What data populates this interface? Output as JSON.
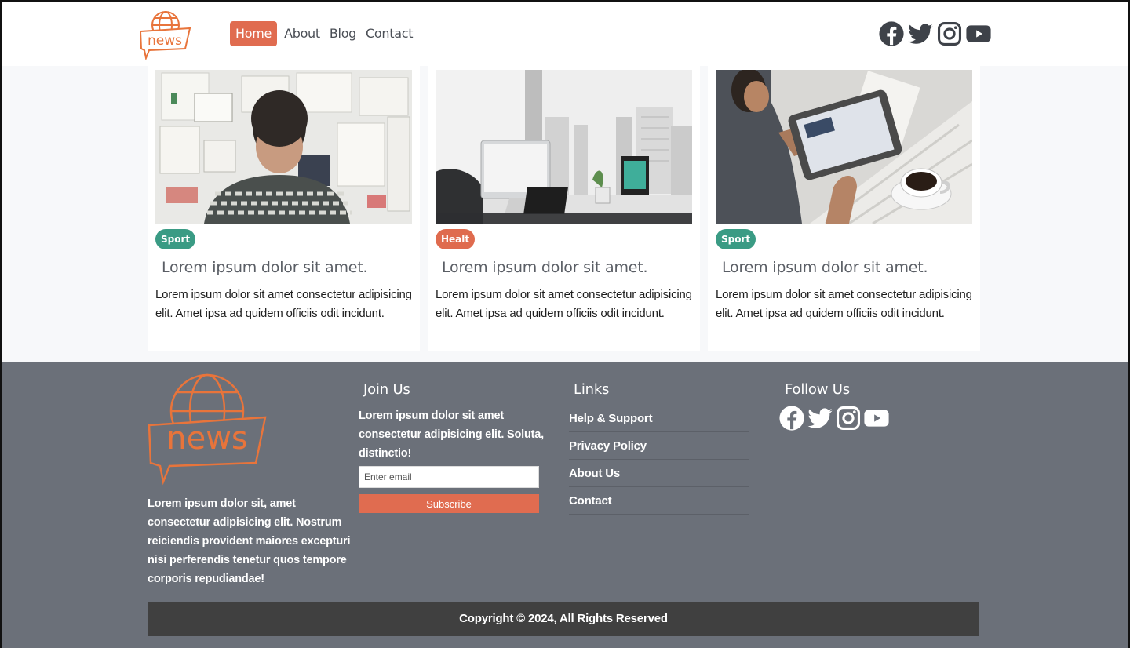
{
  "header": {
    "logo_text": "news",
    "nav": [
      {
        "label": "Home",
        "active": true
      },
      {
        "label": "About",
        "active": false
      },
      {
        "label": "Blog",
        "active": false
      },
      {
        "label": "Contact",
        "active": false
      }
    ],
    "social_icons": [
      "facebook-icon",
      "twitter-icon",
      "instagram-icon",
      "youtube-icon"
    ]
  },
  "cards": [
    {
      "image": "man-looking-at-moodboard-photo",
      "badge": "Sport",
      "badge_color": "#3a9b84",
      "title": "Lorem ipsum dolor sit amet.",
      "text": "Lorem ipsum dolor sit amet consectetur adipisicing elit. Amet ipsa ad quidem officiis odit incidunt."
    },
    {
      "image": "office-desk-with-imac-photo",
      "badge": "Healt",
      "badge_color": "#df6b4e",
      "title": "Lorem ipsum dolor sit amet.",
      "text": "Lorem ipsum dolor sit amet consectetur adipisicing elit. Amet ipsa ad quidem officiis odit incidunt."
    },
    {
      "image": "man-reading-tablet-photo",
      "badge": "Sport",
      "badge_color": "#3a9b84",
      "title": "Lorem ipsum dolor sit amet.",
      "text": "Lorem ipsum dolor sit amet consectetur adipisicing elit. Amet ipsa ad quidem officiis odit incidunt."
    }
  ],
  "footer": {
    "about_text": "Lorem ipsum dolor sit, amet consectetur adipisicing elit. Nostrum reiciendis provident maiores excepturi nisi perferendis tenetur quos tempore corporis repudiandae!",
    "join": {
      "title": "Join Us",
      "text": "Lorem ipsum dolor sit amet consectetur adipisicing elit. Soluta, distinctio!",
      "email_placeholder": "Enter email",
      "subscribe_label": "Subscribe"
    },
    "links": {
      "title": "Links",
      "items": [
        "Help & Support",
        "Privacy Policy",
        "About Us",
        "Contact"
      ]
    },
    "follow": {
      "title": "Follow Us"
    },
    "copyright": "Copyright © 2024, All Rights Reserved"
  },
  "colors": {
    "accent": "#e06c50",
    "sport": "#3a9b84",
    "footer_bg": "#6b7079",
    "copyright_bg": "#404040"
  }
}
